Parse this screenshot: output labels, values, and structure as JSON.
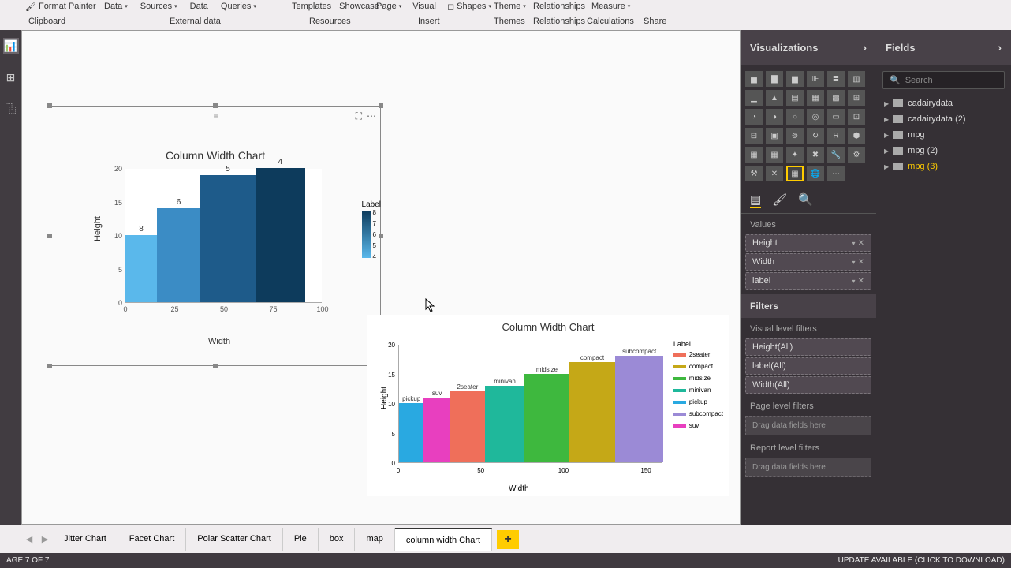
{
  "ribbon": {
    "format_painter": "Format Painter",
    "data": "Data",
    "sources": "Sources",
    "data2": "Data",
    "queries": "Queries",
    "templates": "Templates",
    "showcase": "Showcase",
    "page": "Page",
    "visual": "Visual",
    "shapes": "Shapes",
    "theme": "Theme",
    "relationships": "Relationships",
    "measure": "Measure",
    "groups": {
      "clipboard": "Clipboard",
      "external_data": "External data",
      "resources": "Resources",
      "insert": "Insert",
      "themes": "Themes",
      "relationships2": "Relationships",
      "calculations": "Calculations",
      "share": "Share"
    }
  },
  "chart_data": [
    {
      "type": "bar",
      "title": "Column Width Chart",
      "xlabel": "Width",
      "ylabel": "Height",
      "ylim": [
        0,
        20
      ],
      "xlim": [
        0,
        100
      ],
      "x_ticks": [
        0,
        25,
        50,
        75,
        100
      ],
      "y_ticks": [
        0,
        5,
        10,
        15,
        20
      ],
      "bars": [
        {
          "label": "8",
          "x_start": 0,
          "width": 16,
          "height": 10,
          "color": "#5ab8eb"
        },
        {
          "label": "6",
          "x_start": 16,
          "width": 22,
          "height": 14,
          "color": "#3b8cc5"
        },
        {
          "label": "5",
          "x_start": 38,
          "width": 28,
          "height": 19,
          "color": "#1e5b8a"
        },
        {
          "label": "4",
          "x_start": 66,
          "width": 25,
          "height": 20,
          "color": "#0d3b5c"
        }
      ],
      "legend": {
        "title": "Label",
        "scale": [
          4,
          5,
          6,
          7,
          8
        ]
      }
    },
    {
      "type": "bar",
      "title": "Column Width Chart",
      "xlabel": "Width",
      "ylabel": "Height",
      "ylim": [
        0,
        20
      ],
      "xlim": [
        0,
        160
      ],
      "x_ticks": [
        0,
        50,
        100,
        150
      ],
      "y_ticks": [
        0,
        5,
        10,
        15,
        20
      ],
      "bars": [
        {
          "label": "pickup",
          "x_start": 0,
          "width": 15,
          "height": 10,
          "color": "#29a9e1"
        },
        {
          "label": "suv",
          "x_start": 15,
          "width": 16,
          "height": 11,
          "color": "#e83fbf"
        },
        {
          "label": "2seater",
          "x_start": 31,
          "width": 21,
          "height": 12,
          "color": "#ef6f5a"
        },
        {
          "label": "minivan",
          "x_start": 52,
          "width": 24,
          "height": 13,
          "color": "#1fb89b"
        },
        {
          "label": "midsize",
          "x_start": 76,
          "width": 27,
          "height": 15,
          "color": "#3eb83e"
        },
        {
          "label": "compact",
          "x_start": 103,
          "width": 28,
          "height": 17,
          "color": "#c5a817"
        },
        {
          "label": "subcompact",
          "x_start": 131,
          "width": 29,
          "height": 18,
          "color": "#9b8ad6"
        }
      ],
      "legend": {
        "title": "Label",
        "items": [
          {
            "name": "2seater",
            "color": "#ef6f5a"
          },
          {
            "name": "compact",
            "color": "#c5a817"
          },
          {
            "name": "midsize",
            "color": "#3eb83e"
          },
          {
            "name": "minivan",
            "color": "#1fb89b"
          },
          {
            "name": "pickup",
            "color": "#29a9e1"
          },
          {
            "name": "subcompact",
            "color": "#9b8ad6"
          },
          {
            "name": "suv",
            "color": "#e83fbf"
          }
        ]
      }
    }
  ],
  "viz_panel": {
    "title": "Visualizations",
    "values_label": "Values",
    "values": [
      "Height",
      "Width",
      "label"
    ],
    "filters_title": "Filters",
    "visual_filters_label": "Visual level filters",
    "visual_filters": [
      "Height(All)",
      "label(All)",
      "Width(All)"
    ],
    "page_filters_label": "Page level filters",
    "report_filters_label": "Report level filters",
    "drop_hint": "Drag data fields here"
  },
  "fields_panel": {
    "title": "Fields",
    "search_placeholder": "Search",
    "tables": [
      {
        "name": "cadairydata",
        "selected": false
      },
      {
        "name": "cadairydata (2)",
        "selected": false
      },
      {
        "name": "mpg",
        "selected": false
      },
      {
        "name": "mpg (2)",
        "selected": false
      },
      {
        "name": "mpg (3)",
        "selected": true
      }
    ]
  },
  "pages": {
    "tabs": [
      "Jitter Chart",
      "Facet Chart",
      "Polar Scatter Chart",
      "Pie",
      "box",
      "map",
      "column width Chart"
    ],
    "active_index": 6
  },
  "status": {
    "left": "AGE 7 OF 7",
    "right": "UPDATE AVAILABLE (CLICK TO DOWNLOAD)"
  }
}
